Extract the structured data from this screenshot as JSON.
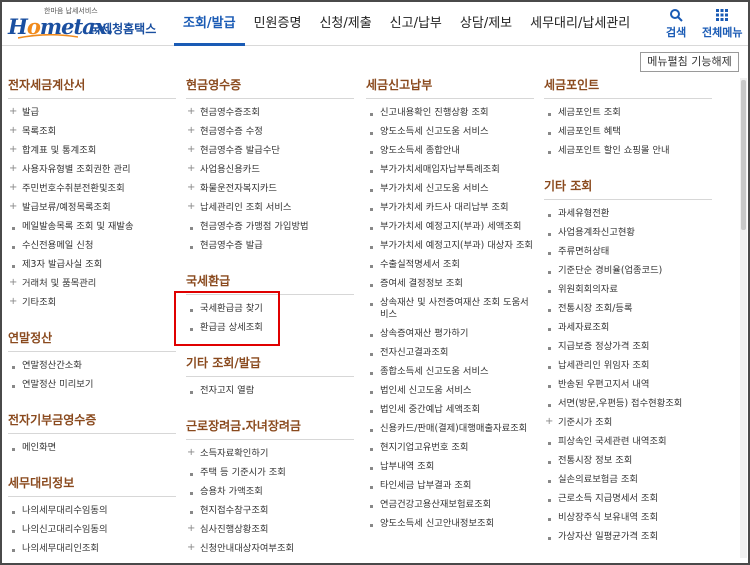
{
  "header": {
    "logo": {
      "slogan": "한마음 납세서비스",
      "text_pre": "H",
      "text_o": "o",
      "text_post": "metax.",
      "korean_name": "국세청홈택스"
    },
    "nav": [
      "조회/발급",
      "민원증명",
      "신청/제출",
      "신고/납부",
      "상담/제보",
      "세무대리/납세관리"
    ],
    "active_nav": "조회/발급",
    "search_label": "검색",
    "all_menu_label": "전체메뉴"
  },
  "menu_release_button": "메뉴펼침 기능해제",
  "colors": {
    "brand_blue": "#1a5bb5",
    "section_title": "#8a4a1e",
    "highlight_red": "#e00000",
    "logo_orange": "#f08a1c"
  },
  "columns": [
    {
      "sections": [
        {
          "title": "전자세금계산서",
          "items": [
            {
              "label": "발급",
              "marker": "plus"
            },
            {
              "label": "목록조회",
              "marker": "plus"
            },
            {
              "label": "합계표 및 통계조회",
              "marker": "plus"
            },
            {
              "label": "사용자유형별 조회권한 관리",
              "marker": "plus"
            },
            {
              "label": "주민번호수취분전환및조회",
              "marker": "plus"
            },
            {
              "label": "발급보류/예정목록조회",
              "marker": "plus"
            },
            {
              "label": "메일발송목록 조회 및 재발송",
              "marker": "dot"
            },
            {
              "label": "수신전용메일 신청",
              "marker": "dot"
            },
            {
              "label": "제3자 발급사실 조회",
              "marker": "dot"
            },
            {
              "label": "거래처 및 품목관리",
              "marker": "plus"
            },
            {
              "label": "기타조회",
              "marker": "plus"
            }
          ]
        },
        {
          "title": "연말정산",
          "items": [
            {
              "label": "연말정산간소화",
              "marker": "dot"
            },
            {
              "label": "연말정산 미리보기",
              "marker": "dot"
            }
          ]
        },
        {
          "title": "전자기부금영수증",
          "items": [
            {
              "label": "메인화면",
              "marker": "dot"
            }
          ]
        },
        {
          "title": "세무대리정보",
          "items": [
            {
              "label": "나의세무대리수임동의",
              "marker": "dot"
            },
            {
              "label": "나의신고대리수임동의",
              "marker": "dot"
            },
            {
              "label": "나의세무대리인조회",
              "marker": "dot"
            }
          ]
        }
      ]
    },
    {
      "sections": [
        {
          "title": "현금영수증",
          "items": [
            {
              "label": "현금영수증조회",
              "marker": "plus"
            },
            {
              "label": "현금영수증 수정",
              "marker": "plus"
            },
            {
              "label": "현금영수증 발급수단",
              "marker": "plus"
            },
            {
              "label": "사업용신용카드",
              "marker": "plus"
            },
            {
              "label": "화물운전자복지카드",
              "marker": "plus"
            },
            {
              "label": "납세관리인 조회 서비스",
              "marker": "plus"
            },
            {
              "label": "현금영수증 가맹점 가입방법",
              "marker": "dot"
            },
            {
              "label": "현금영수증 발급",
              "marker": "dot"
            }
          ]
        },
        {
          "title": "국세환급",
          "items": [
            {
              "label": "국세환급금 찾기",
              "marker": "dot"
            },
            {
              "label": "환급금 상세조회",
              "marker": "dot"
            }
          ]
        },
        {
          "title": "기타 조회/발급",
          "items": [
            {
              "label": "전자고지 열람",
              "marker": "dot"
            }
          ]
        },
        {
          "title": "근로장려금.자녀장려금",
          "items": [
            {
              "label": "소득자료확인하기",
              "marker": "plus"
            },
            {
              "label": "주택 등 기준시가 조회",
              "marker": "dot"
            },
            {
              "label": "승용차 가액조회",
              "marker": "dot"
            },
            {
              "label": "현지접수창구조회",
              "marker": "dot"
            },
            {
              "label": "심사진행상황조회",
              "marker": "plus"
            },
            {
              "label": "신청안내대상자여부조회",
              "marker": "plus"
            }
          ]
        }
      ]
    },
    {
      "sections": [
        {
          "title": "세금신고납부",
          "items": [
            {
              "label": "신고내용확인 진행상황 조회",
              "marker": "dot"
            },
            {
              "label": "양도소득세 신고도움 서비스",
              "marker": "dot"
            },
            {
              "label": "양도소득세 종합안내",
              "marker": "dot"
            },
            {
              "label": "부가가치세매입자납부특례조회",
              "marker": "dot"
            },
            {
              "label": "부가가치세 신고도움 서비스",
              "marker": "dot"
            },
            {
              "label": "부가가치세 카드사 대리납부 조회",
              "marker": "dot"
            },
            {
              "label": "부가가치세 예정고지(부과) 세액조회",
              "marker": "dot"
            },
            {
              "label": "부가가치세 예정고지(부과) 대상자 조회",
              "marker": "dot"
            },
            {
              "label": "수출실적명세서 조회",
              "marker": "dot"
            },
            {
              "label": "증여세 결정정보 조회",
              "marker": "dot"
            },
            {
              "label": "상속재산 및 사전증여재산 조회 도움서비스",
              "marker": "dot"
            },
            {
              "label": "상속증여재산 평가하기",
              "marker": "dot"
            },
            {
              "label": "전자신고결과조회",
              "marker": "dot"
            },
            {
              "label": "종합소득세 신고도움 서비스",
              "marker": "dot"
            },
            {
              "label": "법인세 신고도움 서비스",
              "marker": "dot"
            },
            {
              "label": "법인세 중간예납 세액조회",
              "marker": "dot"
            },
            {
              "label": "신용카드/판매(결제)대행매출자료조회",
              "marker": "dot"
            },
            {
              "label": "현지기업고유번호 조회",
              "marker": "dot"
            },
            {
              "label": "납부내역 조회",
              "marker": "dot"
            },
            {
              "label": "타인세금 납부결과 조회",
              "marker": "dot"
            },
            {
              "label": "연금건강고용산재보험료조회",
              "marker": "dot"
            },
            {
              "label": "양도소득세 신고안내정보조회",
              "marker": "dot"
            }
          ]
        }
      ]
    },
    {
      "sections": [
        {
          "title": "세금포인트",
          "items": [
            {
              "label": "세금포인트 조회",
              "marker": "dot"
            },
            {
              "label": "세금포인트 혜택",
              "marker": "dot"
            },
            {
              "label": "세금포인트 할인 쇼핑몰 안내",
              "marker": "dot"
            }
          ]
        },
        {
          "title": "기타 조회",
          "items": [
            {
              "label": "과세유형전환",
              "marker": "dot"
            },
            {
              "label": "사업용계좌신고현황",
              "marker": "dot"
            },
            {
              "label": "주류면허상태",
              "marker": "dot"
            },
            {
              "label": "기준단순 경비율(업종코드)",
              "marker": "dot"
            },
            {
              "label": "위원회회의자료",
              "marker": "dot"
            },
            {
              "label": "전통시장 조회/등록",
              "marker": "dot"
            },
            {
              "label": "과세자료조회",
              "marker": "dot"
            },
            {
              "label": "지급보증 정상가격 조회",
              "marker": "dot"
            },
            {
              "label": "납세관리인 위임자 조회",
              "marker": "dot"
            },
            {
              "label": "반송된 우편고지서 내역",
              "marker": "dot"
            },
            {
              "label": "서면(방문,우편등) 접수현황조회",
              "marker": "dot"
            },
            {
              "label": "기준시가 조회",
              "marker": "plus"
            },
            {
              "label": "피상속인 국세관련 내역조회",
              "marker": "dot"
            },
            {
              "label": "전통시장 정보 조회",
              "marker": "dot"
            },
            {
              "label": "실손의료보험금 조회",
              "marker": "dot"
            },
            {
              "label": "근로소득 지급명세서 조회",
              "marker": "dot"
            },
            {
              "label": "비상장주식 보유내역 조회",
              "marker": "dot"
            },
            {
              "label": "가상자산 일평균가격 조회",
              "marker": "dot"
            }
          ]
        }
      ]
    }
  ]
}
